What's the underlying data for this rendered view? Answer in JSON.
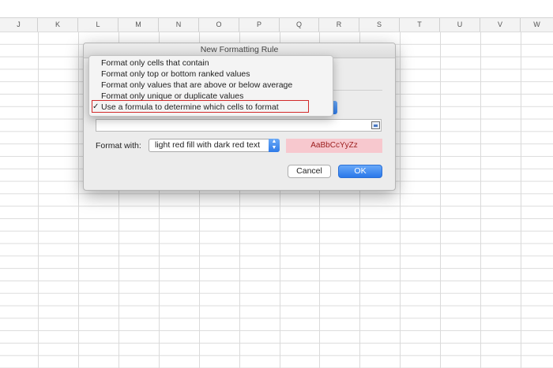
{
  "spreadsheet": {
    "columns": [
      "J",
      "K",
      "L",
      "M",
      "N",
      "O",
      "P",
      "Q",
      "R",
      "S",
      "T",
      "U",
      "V",
      "W"
    ]
  },
  "dialog": {
    "title": "New Formatting Rule",
    "format_with_label": "Format with:",
    "format_style_value": "light red fill with dark red text",
    "preview_text": "AaBbCcYyZz",
    "cancel_label": "Cancel",
    "ok_label": "OK",
    "formula_value": ""
  },
  "menu": {
    "items": [
      "Format only cells that contain",
      "Format only top or bottom ranked values",
      "Format only values that are above or below average",
      "Format only unique or duplicate values",
      "Use a formula to determine which cells to format"
    ],
    "checkmark": "✓"
  },
  "colors": {
    "preview_fill": "#f7c8ce",
    "preview_text": "#9b1c1c",
    "accent_blue": "#2f7be8",
    "highlight_red": "#d22a2a"
  }
}
